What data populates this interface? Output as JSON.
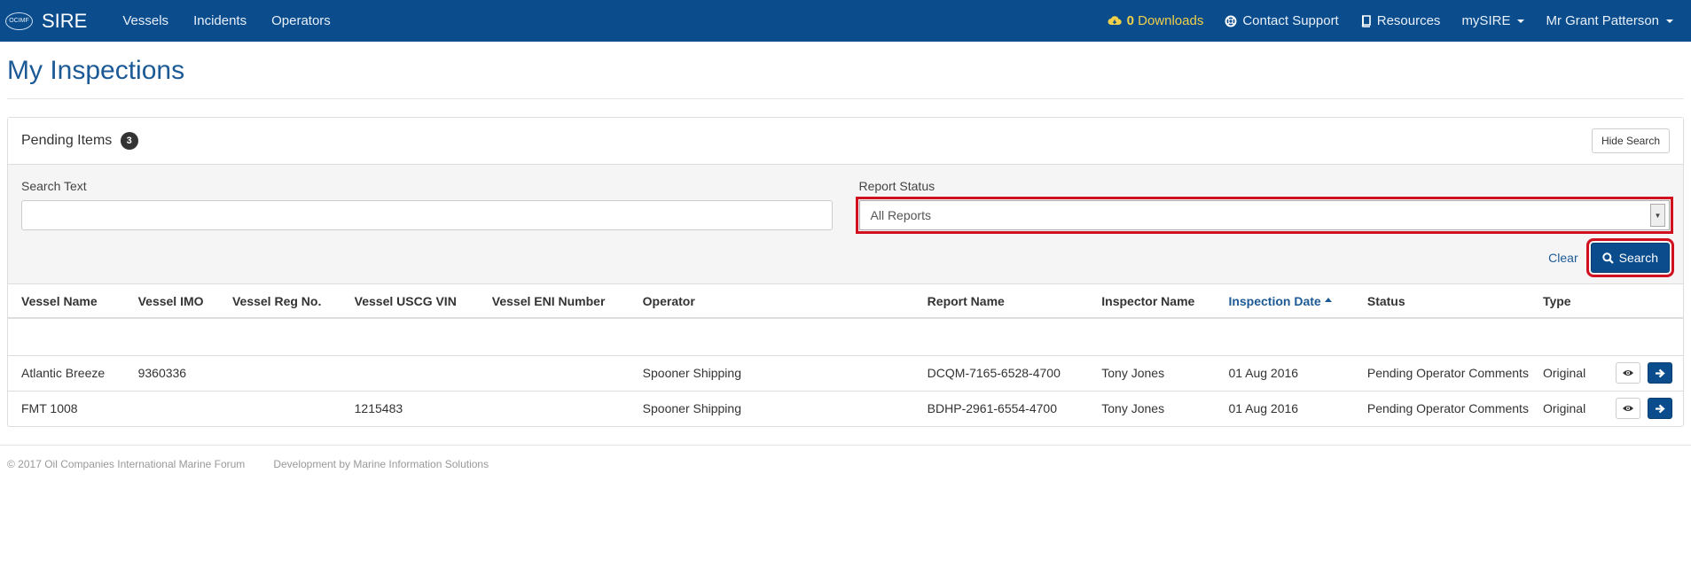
{
  "nav": {
    "logo_text": "OCIMF",
    "brand": "SIRE",
    "left_items": [
      "Vessels",
      "Incidents",
      "Operators"
    ],
    "downloads_count": "0",
    "downloads_label": "Downloads",
    "contact_support": "Contact Support",
    "resources": "Resources",
    "mysire": "mySIRE",
    "user": "Mr Grant Patterson",
    "downloads_color": "#f0d04a",
    "bar_color": "#0a4c8c"
  },
  "page": {
    "title": "My Inspections"
  },
  "panel": {
    "title": "Pending Items",
    "badge_count": "3",
    "hide_search_label": "Hide Search"
  },
  "search": {
    "search_text_label": "Search Text",
    "search_text_value": "",
    "report_status_label": "Report Status",
    "report_status_selected": "All Reports",
    "clear_label": "Clear",
    "search_button_label": "Search"
  },
  "table": {
    "columns": [
      "Vessel Name",
      "Vessel IMO",
      "Vessel Reg No.",
      "Vessel USCG VIN",
      "Vessel ENI Number",
      "Operator",
      "Report Name",
      "Inspector Name",
      "Inspection Date",
      "Status",
      "Type"
    ],
    "sorted_column": "Inspection Date",
    "rows": [
      {
        "vessel_name": "Atlantic Breeze",
        "imo": "9360336",
        "reg_no": "",
        "uscg_vin": "",
        "eni": "",
        "operator": "Spooner Shipping",
        "report_name": "DCQM-7165-6528-4700",
        "inspector": "Tony Jones",
        "date": "01 Aug 2016",
        "status": "Pending Operator Comments",
        "type": "Original"
      },
      {
        "vessel_name": "FMT 1008",
        "imo": "",
        "reg_no": "",
        "uscg_vin": "1215483",
        "eni": "",
        "operator": "Spooner Shipping",
        "report_name": "BDHP-2961-6554-4700",
        "inspector": "Tony Jones",
        "date": "01 Aug 2016",
        "status": "Pending Operator Comments",
        "type": "Original"
      }
    ]
  },
  "footer": {
    "copyright": "© 2017 Oil Companies International Marine Forum",
    "developer": "Development by Marine Information Solutions"
  },
  "icons": [
    "cloud-download-icon",
    "lifebuoy-icon",
    "book-icon",
    "search-icon",
    "eye-icon",
    "arrow-right-icon"
  ],
  "highlight_color": "#d0101e"
}
